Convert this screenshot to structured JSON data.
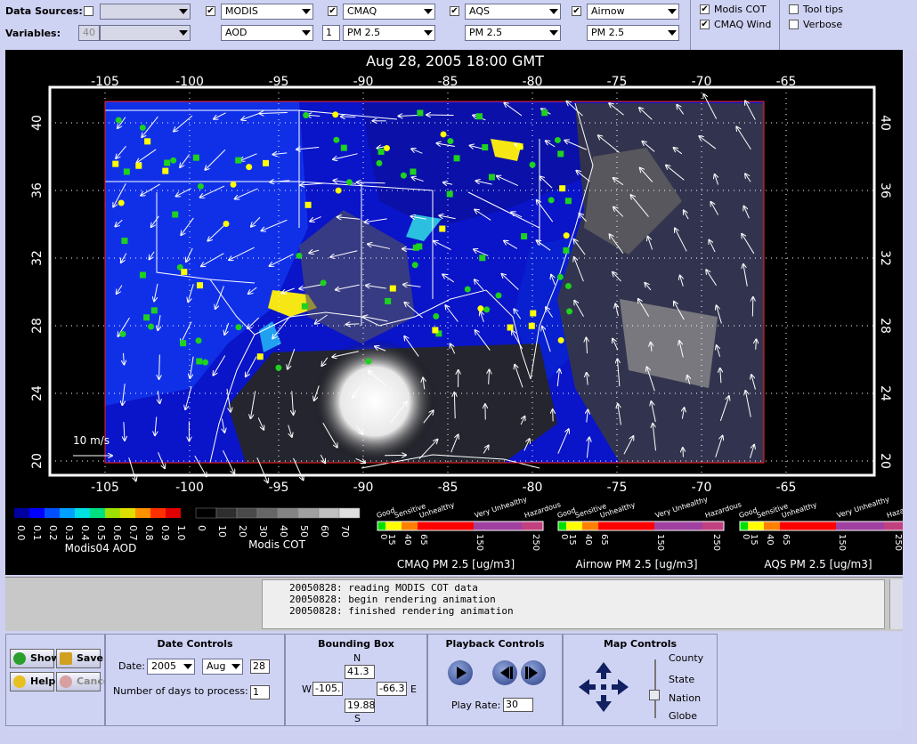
{
  "toolbar": {
    "data_sources_label": "Data Sources:",
    "variables_label": "Variables:",
    "variables_value": "40",
    "modis": {
      "label": "MODIS",
      "variable": "AOD",
      "checked": true
    },
    "cmaq": {
      "label": "CMAQ",
      "variable": "PM 2.5",
      "layer": "1",
      "checked": true
    },
    "aqs": {
      "label": "AQS",
      "variable": "PM 2.5",
      "checked": true
    },
    "airnow": {
      "label": "Airnow",
      "variable": "PM 2.5",
      "checked": true
    },
    "modis_cot": {
      "label": "Modis COT",
      "checked": true
    },
    "cmaq_wind": {
      "label": "CMAQ Wind",
      "checked": true
    },
    "tool_tips": {
      "label": "Tool tips",
      "checked": false
    },
    "verbose": {
      "label": "Verbose",
      "checked": false
    }
  },
  "map": {
    "title": "Aug 28, 2005 18:00 GMT",
    "lon_ticks": [
      "-105",
      "-100",
      "-95",
      "-90",
      "-85",
      "-80",
      "-75",
      "-70",
      "-65"
    ],
    "lat_ticks": [
      "40",
      "36",
      "32",
      "28",
      "24",
      "20"
    ],
    "wind_scale": "10 m/s",
    "colors": {
      "background": "#000000",
      "frame": "#ffffff",
      "domain_box": "#ff2020",
      "aod_low": "#0a14c8",
      "aod_high": "#f5e614",
      "site_good": "#1ed21e",
      "site_moderate": "#ffff00",
      "wind_arrow": "#ffffff"
    }
  },
  "legends": {
    "aod": {
      "title": "Modis04 AOD",
      "labels": [
        "0.0",
        "0.1",
        "0.2",
        "0.3",
        "0.4",
        "0.5",
        "0.6",
        "0.7",
        "0.8",
        "0.9",
        "1.0"
      ],
      "colors": [
        "#0000a0",
        "#0000ff",
        "#0050ff",
        "#00a0ff",
        "#00e0e0",
        "#00e080",
        "#a0e000",
        "#e0e000",
        "#ff9000",
        "#ff3000",
        "#e00000"
      ]
    },
    "cot": {
      "title": "Modis COT",
      "labels": [
        "0",
        "10",
        "20",
        "30",
        "40",
        "50",
        "60",
        "70"
      ],
      "colors": [
        "#000000",
        "#2e2e2e",
        "#4a4a4a",
        "#666666",
        "#838383",
        "#a0a0a0",
        "#c0c0c0",
        "#e0e0e0"
      ]
    },
    "pm_scales": [
      {
        "title": "CMAQ PM 2.5 [ug/m3]",
        "labels": [
          "0",
          "15",
          "40",
          "65",
          "150",
          "250"
        ]
      },
      {
        "title": "Airnow PM 2.5 [ug/m3]",
        "labels": [
          "0",
          "15",
          "40",
          "65",
          "150",
          "250"
        ]
      },
      {
        "title": "AQS PM 2.5 [ug/m3]",
        "labels": [
          "0",
          "15",
          "40",
          "65",
          "150",
          "250"
        ]
      }
    ],
    "pm_categories": [
      "Good",
      "Sensitive",
      "Unhealthy",
      "Very Unhealthy",
      "Hazardous"
    ],
    "pm_colors": [
      "#00e000",
      "#ffff00",
      "#ff8000",
      "#ff0000",
      "#a040a0",
      "#c04080"
    ]
  },
  "log": {
    "lines": [
      "20050828: reading MODIS COT data",
      "20050828: begin rendering animation",
      "20050828: finished rendering animation"
    ]
  },
  "buttons": {
    "show": "Show",
    "save": "Save",
    "help": "Help",
    "cancel": "Cancel"
  },
  "date_controls": {
    "title": "Date Controls",
    "date_label": "Date:",
    "year": "2005",
    "month": "Aug",
    "day": "28",
    "days_label": "Number of days to process:",
    "days": "1"
  },
  "bounding_box": {
    "title": "Bounding Box",
    "n_label": "N",
    "s_label": "S",
    "w_label": "W",
    "e_label": "E",
    "north": "41.3",
    "south": "19.88",
    "west": "-105.",
    "east": "-66.3"
  },
  "playback": {
    "title": "Playback Controls",
    "rate_label": "Play Rate:",
    "rate": "30"
  },
  "map_controls": {
    "title": "Map Controls",
    "levels": [
      "County",
      "State",
      "Nation",
      "Globe"
    ],
    "selected_level": "Nation"
  }
}
